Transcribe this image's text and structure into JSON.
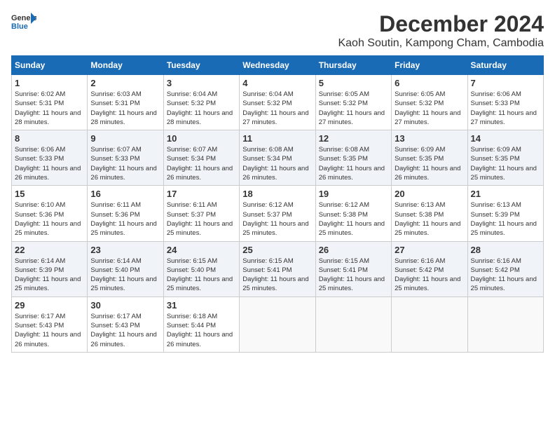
{
  "header": {
    "logo_line1": "General",
    "logo_line2": "Blue",
    "month_title": "December 2024",
    "location": "Kaoh Soutin, Kampong Cham, Cambodia"
  },
  "weekdays": [
    "Sunday",
    "Monday",
    "Tuesday",
    "Wednesday",
    "Thursday",
    "Friday",
    "Saturday"
  ],
  "weeks": [
    [
      {
        "day": "1",
        "sunrise": "6:02 AM",
        "sunset": "5:31 PM",
        "daylight": "11 hours and 28 minutes."
      },
      {
        "day": "2",
        "sunrise": "6:03 AM",
        "sunset": "5:31 PM",
        "daylight": "11 hours and 28 minutes."
      },
      {
        "day": "3",
        "sunrise": "6:04 AM",
        "sunset": "5:32 PM",
        "daylight": "11 hours and 28 minutes."
      },
      {
        "day": "4",
        "sunrise": "6:04 AM",
        "sunset": "5:32 PM",
        "daylight": "11 hours and 27 minutes."
      },
      {
        "day": "5",
        "sunrise": "6:05 AM",
        "sunset": "5:32 PM",
        "daylight": "11 hours and 27 minutes."
      },
      {
        "day": "6",
        "sunrise": "6:05 AM",
        "sunset": "5:32 PM",
        "daylight": "11 hours and 27 minutes."
      },
      {
        "day": "7",
        "sunrise": "6:06 AM",
        "sunset": "5:33 PM",
        "daylight": "11 hours and 27 minutes."
      }
    ],
    [
      {
        "day": "8",
        "sunrise": "6:06 AM",
        "sunset": "5:33 PM",
        "daylight": "11 hours and 26 minutes."
      },
      {
        "day": "9",
        "sunrise": "6:07 AM",
        "sunset": "5:33 PM",
        "daylight": "11 hours and 26 minutes."
      },
      {
        "day": "10",
        "sunrise": "6:07 AM",
        "sunset": "5:34 PM",
        "daylight": "11 hours and 26 minutes."
      },
      {
        "day": "11",
        "sunrise": "6:08 AM",
        "sunset": "5:34 PM",
        "daylight": "11 hours and 26 minutes."
      },
      {
        "day": "12",
        "sunrise": "6:08 AM",
        "sunset": "5:35 PM",
        "daylight": "11 hours and 26 minutes."
      },
      {
        "day": "13",
        "sunrise": "6:09 AM",
        "sunset": "5:35 PM",
        "daylight": "11 hours and 26 minutes."
      },
      {
        "day": "14",
        "sunrise": "6:09 AM",
        "sunset": "5:35 PM",
        "daylight": "11 hours and 25 minutes."
      }
    ],
    [
      {
        "day": "15",
        "sunrise": "6:10 AM",
        "sunset": "5:36 PM",
        "daylight": "11 hours and 25 minutes."
      },
      {
        "day": "16",
        "sunrise": "6:11 AM",
        "sunset": "5:36 PM",
        "daylight": "11 hours and 25 minutes."
      },
      {
        "day": "17",
        "sunrise": "6:11 AM",
        "sunset": "5:37 PM",
        "daylight": "11 hours and 25 minutes."
      },
      {
        "day": "18",
        "sunrise": "6:12 AM",
        "sunset": "5:37 PM",
        "daylight": "11 hours and 25 minutes."
      },
      {
        "day": "19",
        "sunrise": "6:12 AM",
        "sunset": "5:38 PM",
        "daylight": "11 hours and 25 minutes."
      },
      {
        "day": "20",
        "sunrise": "6:13 AM",
        "sunset": "5:38 PM",
        "daylight": "11 hours and 25 minutes."
      },
      {
        "day": "21",
        "sunrise": "6:13 AM",
        "sunset": "5:39 PM",
        "daylight": "11 hours and 25 minutes."
      }
    ],
    [
      {
        "day": "22",
        "sunrise": "6:14 AM",
        "sunset": "5:39 PM",
        "daylight": "11 hours and 25 minutes."
      },
      {
        "day": "23",
        "sunrise": "6:14 AM",
        "sunset": "5:40 PM",
        "daylight": "11 hours and 25 minutes."
      },
      {
        "day": "24",
        "sunrise": "6:15 AM",
        "sunset": "5:40 PM",
        "daylight": "11 hours and 25 minutes."
      },
      {
        "day": "25",
        "sunrise": "6:15 AM",
        "sunset": "5:41 PM",
        "daylight": "11 hours and 25 minutes."
      },
      {
        "day": "26",
        "sunrise": "6:15 AM",
        "sunset": "5:41 PM",
        "daylight": "11 hours and 25 minutes."
      },
      {
        "day": "27",
        "sunrise": "6:16 AM",
        "sunset": "5:42 PM",
        "daylight": "11 hours and 25 minutes."
      },
      {
        "day": "28",
        "sunrise": "6:16 AM",
        "sunset": "5:42 PM",
        "daylight": "11 hours and 25 minutes."
      }
    ],
    [
      {
        "day": "29",
        "sunrise": "6:17 AM",
        "sunset": "5:43 PM",
        "daylight": "11 hours and 26 minutes."
      },
      {
        "day": "30",
        "sunrise": "6:17 AM",
        "sunset": "5:43 PM",
        "daylight": "11 hours and 26 minutes."
      },
      {
        "day": "31",
        "sunrise": "6:18 AM",
        "sunset": "5:44 PM",
        "daylight": "11 hours and 26 minutes."
      },
      null,
      null,
      null,
      null
    ]
  ],
  "labels": {
    "sunrise": "Sunrise: ",
    "sunset": "Sunset: ",
    "daylight": "Daylight: "
  }
}
